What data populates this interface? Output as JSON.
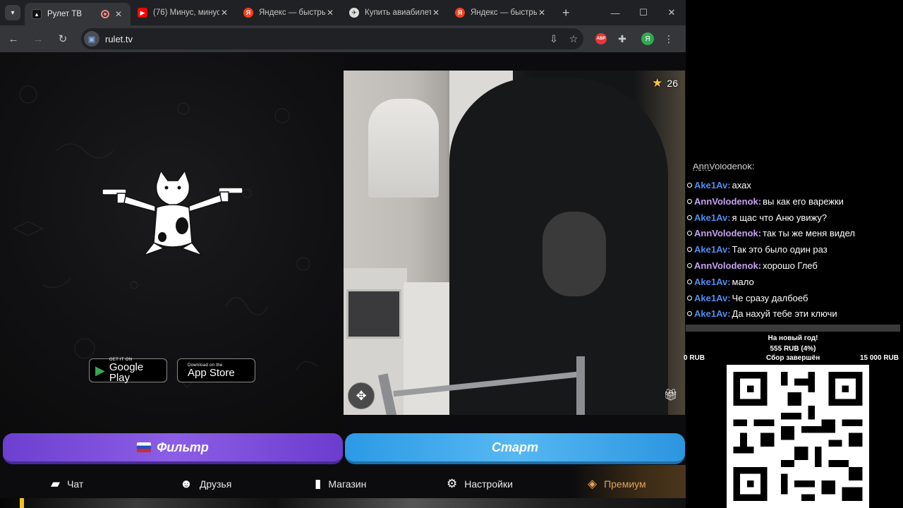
{
  "browser": {
    "tabs": [
      {
        "title": "Рулет ТВ",
        "favicon": "rulet-favicon",
        "active": true,
        "recording": true
      },
      {
        "title": "(76) Минус, минус",
        "favicon": "youtube-icon",
        "active": false
      },
      {
        "title": "Яндекс — быстрый",
        "favicon": "yandex-icon",
        "active": false
      },
      {
        "title": "Купить авиабилет",
        "favicon": "aviasales-icon",
        "active": false
      },
      {
        "title": "Яндекс — быстрый",
        "favicon": "yandex-icon",
        "active": false
      }
    ],
    "new_tab_symbol": "+",
    "url": "rulet.tv",
    "profile_letter": "Я",
    "abp_label": "ABP"
  },
  "page": {
    "store_buttons": {
      "google": {
        "small": "GET IT ON",
        "big": "Google Play"
      },
      "apple": {
        "small": "Download on the",
        "big": "App Store"
      }
    },
    "rating": "26",
    "filter_label": "Фильтр",
    "start_label": "Старт",
    "nav": {
      "chat": "Чат",
      "friends": "Друзья",
      "shop": "Магазин",
      "settings": "Настройки",
      "premium": "Премиум"
    }
  },
  "overlay": {
    "chat_cut": "AnnVolodenok: хаха",
    "chat": [
      {
        "user": "Ake1Av:",
        "text": "ахах",
        "color": "u1"
      },
      {
        "user": "AnnVolodenok:",
        "text": "вы как его варежки",
        "color": "u2"
      },
      {
        "user": "Ake1Av:",
        "text": "я щас что Аню увижу?",
        "color": "u1"
      },
      {
        "user": "AnnVolodenok:",
        "text": "так ты же меня видел",
        "color": "u2"
      },
      {
        "user": "Ake1Av:",
        "text": "Так это было один раз",
        "color": "u1"
      },
      {
        "user": "AnnVolodenok:",
        "text": "хорошо Глеб",
        "color": "u2"
      },
      {
        "user": "Ake1Av:",
        "text": "мало",
        "color": "u1"
      },
      {
        "user": "Ake1Av:",
        "text": "Че сразу далбоеб",
        "color": "u1"
      },
      {
        "user": "Ake1Av:",
        "text": "Да нахуй тебе эти ключи",
        "color": "u1"
      }
    ],
    "goal": {
      "title": "На новый год!",
      "amount": "555 RUB (4%)",
      "min": "0 RUB",
      "status": "Сбор завершён",
      "max": "15 000 RUB"
    }
  }
}
